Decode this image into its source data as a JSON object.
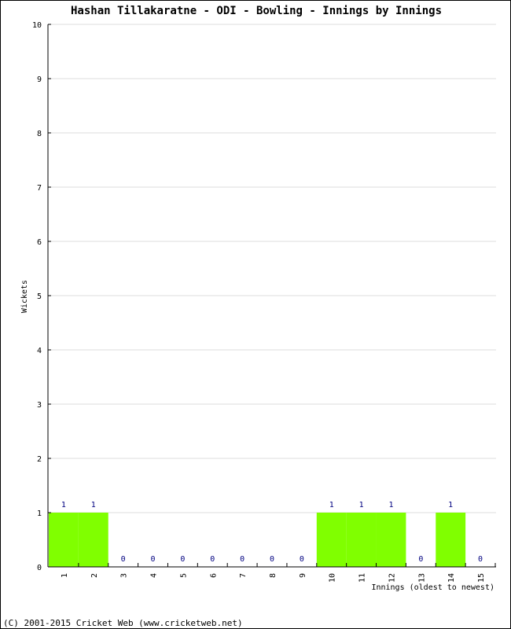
{
  "chart_data": {
    "type": "bar",
    "title": "Hashan Tillakaratne - ODI - Bowling - Innings by Innings",
    "xlabel": "Innings (oldest to newest)",
    "ylabel": "Wickets",
    "categories": [
      "1",
      "2",
      "3",
      "4",
      "5",
      "6",
      "7",
      "8",
      "9",
      "10",
      "11",
      "12",
      "13",
      "14",
      "15"
    ],
    "values": [
      1,
      1,
      0,
      0,
      0,
      0,
      0,
      0,
      0,
      1,
      1,
      1,
      0,
      1,
      0
    ],
    "ylim": [
      0,
      10
    ],
    "yticks": [
      0,
      1,
      2,
      3,
      4,
      5,
      6,
      7,
      8,
      9,
      10
    ],
    "grid": true,
    "bar_color": "#80ff00",
    "label_color": "#000080"
  },
  "footer": "(C) 2001-2015 Cricket Web (www.cricketweb.net)"
}
